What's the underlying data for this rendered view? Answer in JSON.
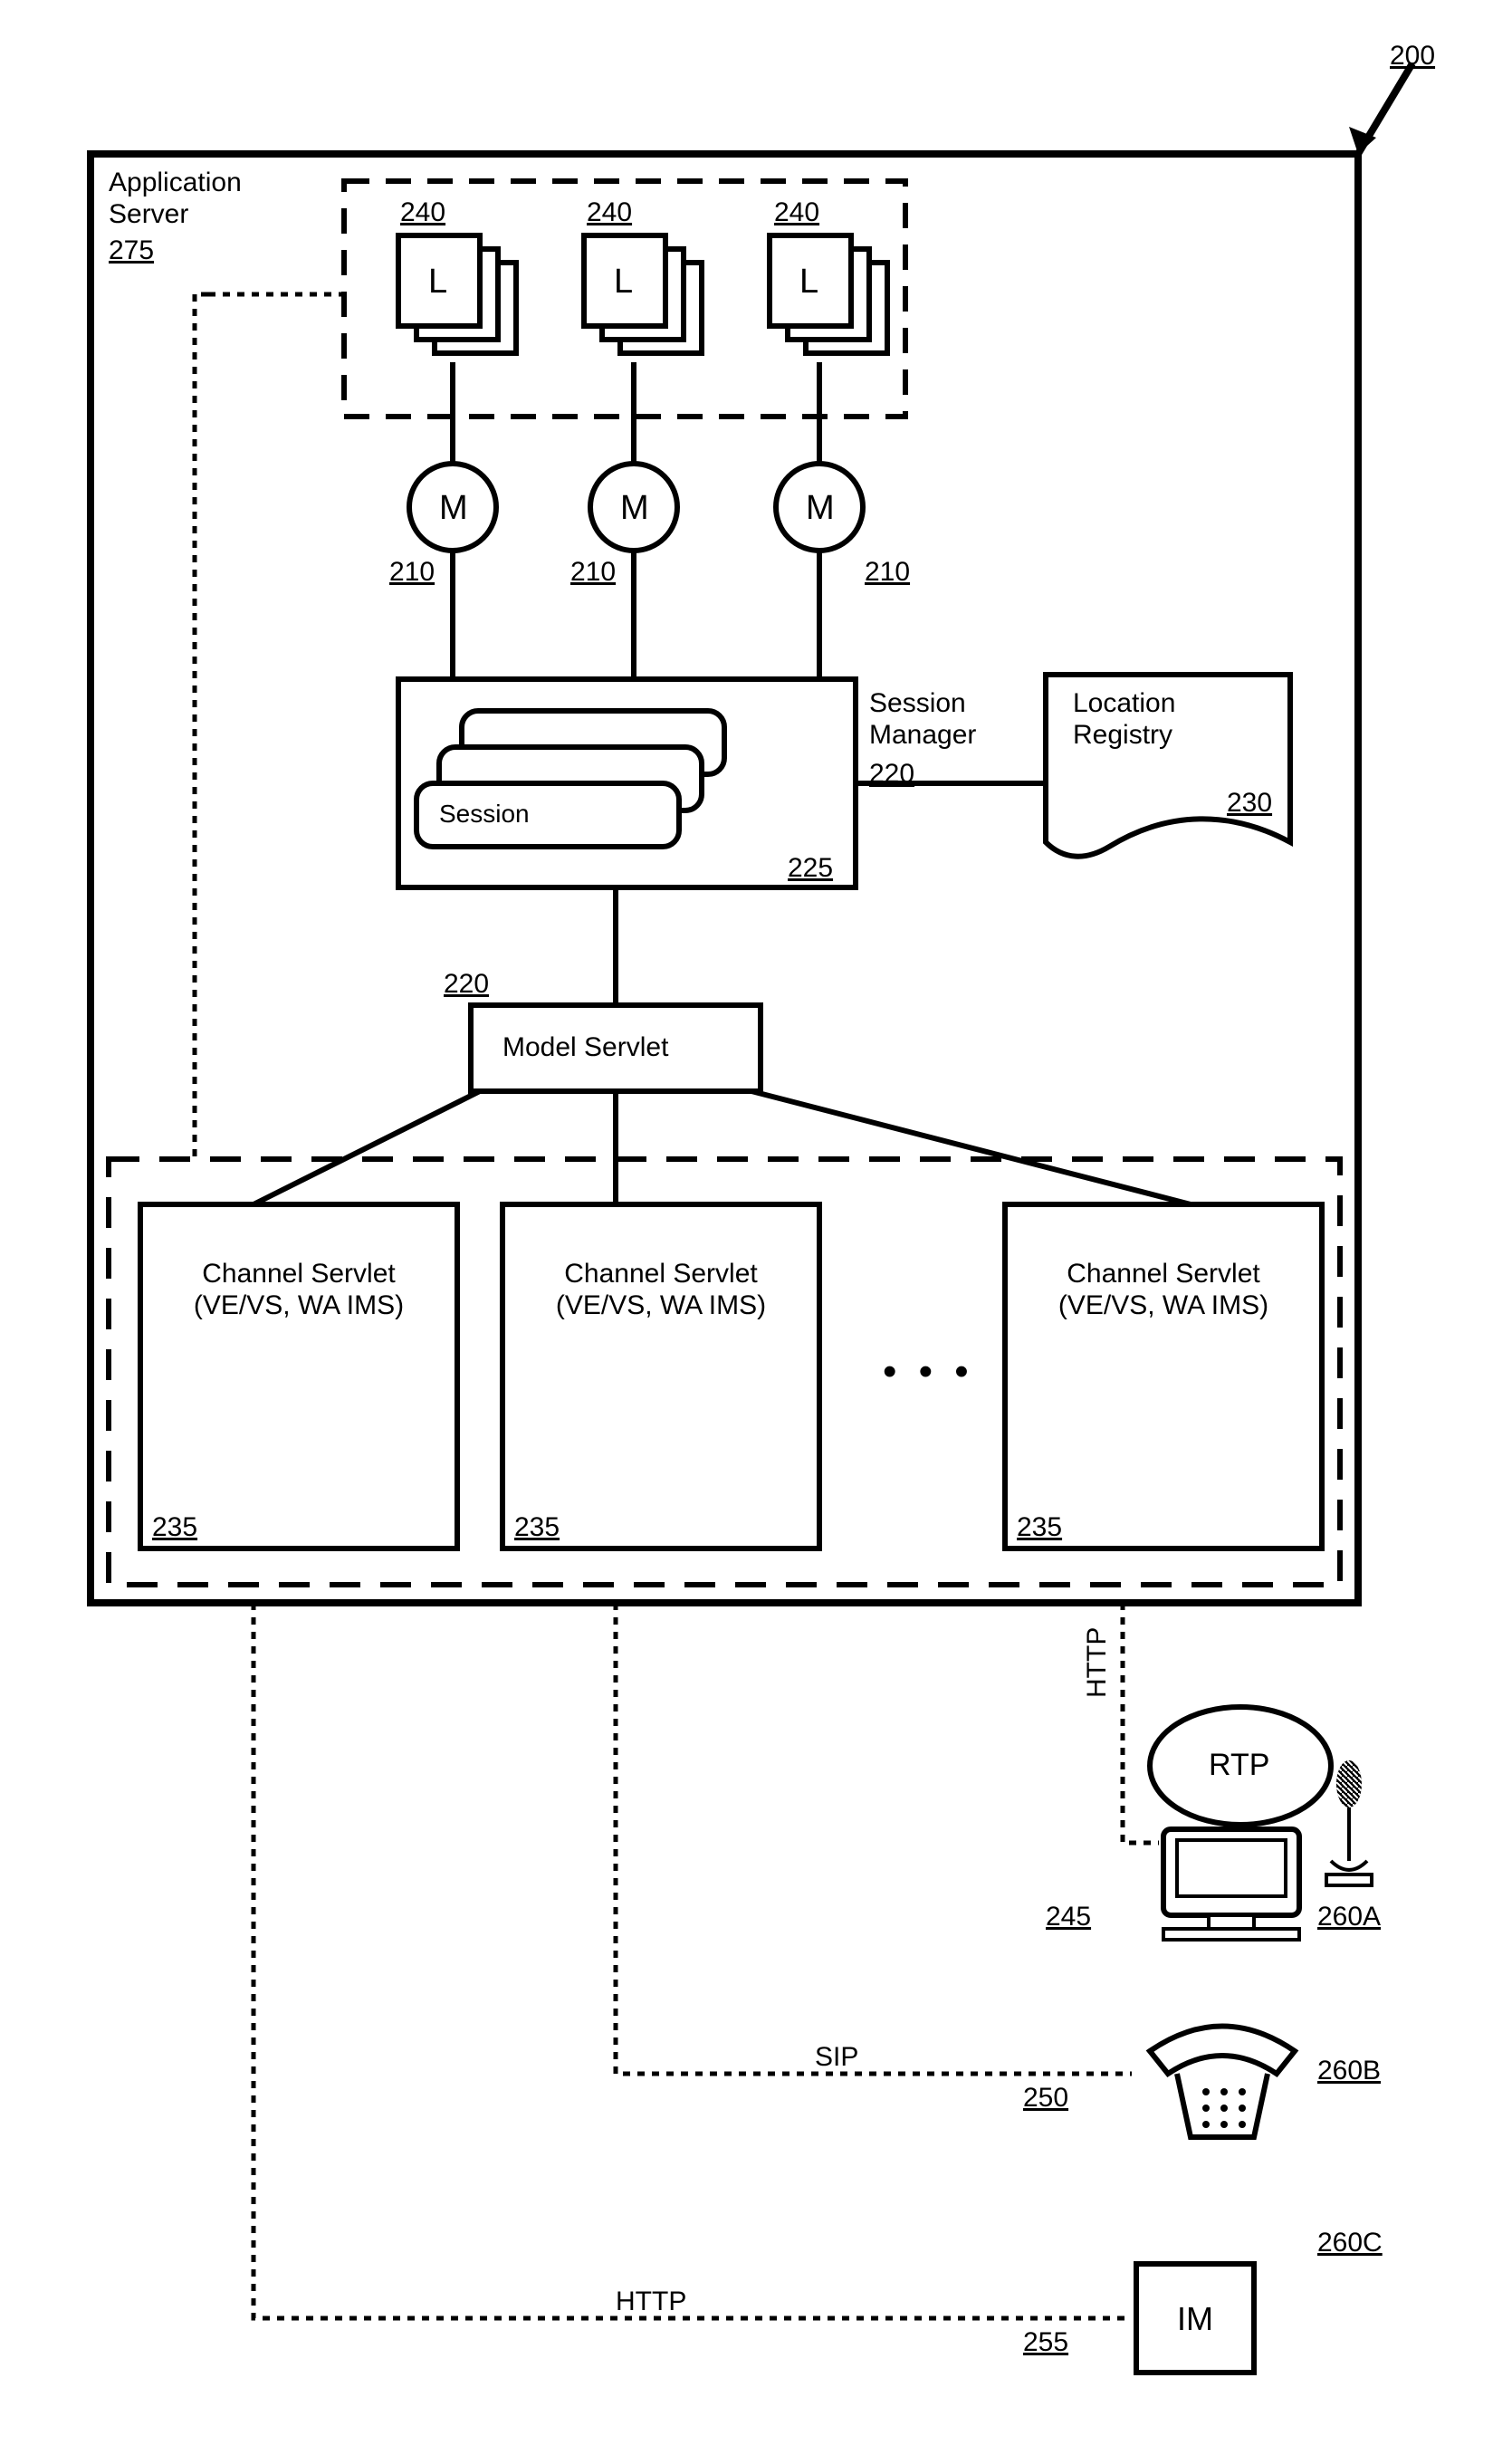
{
  "refs": {
    "system": "200",
    "appServer": "Application\nServer",
    "appServerNum": "275",
    "lGroup": {
      "label": "L",
      "num": "240"
    },
    "mGroup": {
      "label": "M",
      "num": "210"
    },
    "sessionManager": "Session\nManager",
    "sessionManagerNum": "220",
    "sessionLabel": "Session",
    "sessionStackNum": "225",
    "locationRegistry": "Location\nRegistry",
    "locationRegistryNum": "230",
    "modelServlet": "Model Servlet",
    "modelServletNum": "220",
    "channelServlet": "Channel Servlet\n(VE/VS,\nWA\nIMS)",
    "channelServletNum": "235",
    "protoHttp": "HTTP",
    "protoSip": "SIP",
    "rtp": "RTP",
    "rtpNum": "245",
    "computerA": "260A",
    "phone": "260B",
    "phoneLineNum": "250",
    "im": "IM",
    "imBoxNum": "260C",
    "imLineNum": "255",
    "ellipsis": "• • •"
  }
}
